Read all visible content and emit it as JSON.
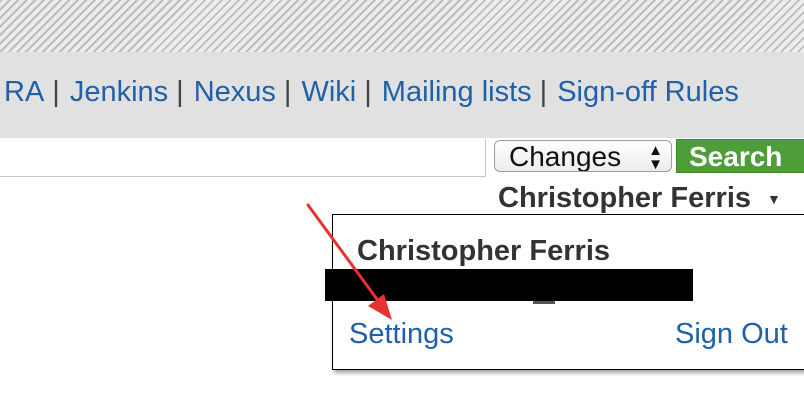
{
  "nav": {
    "links": [
      "RA",
      "Jenkins",
      "Nexus",
      "Wiki",
      "Mailing lists",
      "Sign-off Rules"
    ],
    "separator": "|"
  },
  "search": {
    "query": "",
    "scope_value": "Changes",
    "button_label": "Search"
  },
  "account": {
    "user_name": "Christopher Ferris"
  },
  "popup": {
    "user_name": "Christopher Ferris",
    "settings_label": "Settings",
    "signout_label": "Sign Out"
  },
  "colors": {
    "link": "#2060a8",
    "search_button": "#4d9e38",
    "nav_background": "#e1e1e1",
    "annotation_arrow": "#e83232",
    "redaction": "#000000"
  },
  "icons": {
    "select_arrows": "select-arrows-icon",
    "account_chevron": "chevron-down-icon"
  }
}
